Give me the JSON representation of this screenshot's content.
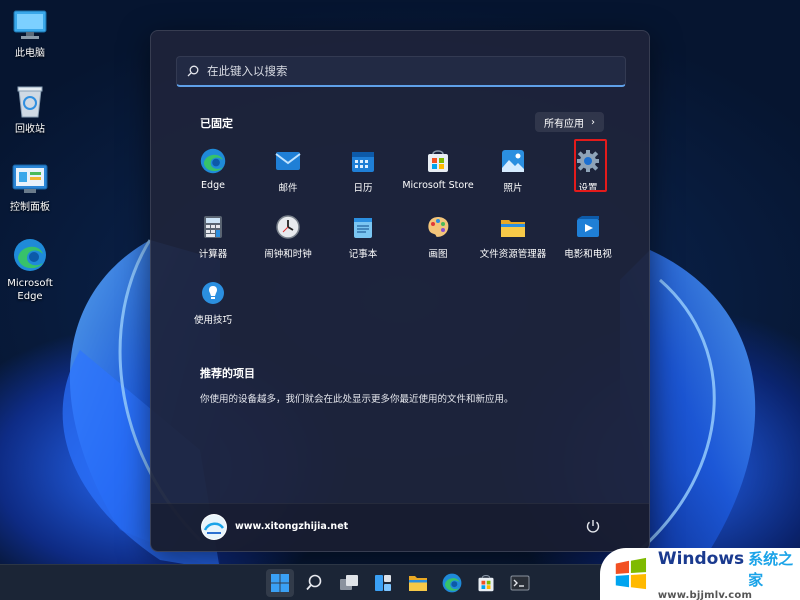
{
  "desktop": {
    "icons": [
      {
        "label": "此电脑",
        "icon": "computer-icon"
      },
      {
        "label": "回收站",
        "icon": "recycle-bin-icon"
      },
      {
        "label": "控制面板",
        "icon": "control-panel-icon"
      },
      {
        "label": "Microsoft\nEdge",
        "icon": "edge-icon"
      }
    ]
  },
  "start_menu": {
    "search_placeholder": "在此键入以搜索",
    "pinned_title": "已固定",
    "all_apps_label": "所有应用",
    "pinned_apps": [
      {
        "name": "Edge",
        "icon": "edge-icon"
      },
      {
        "name": "邮件",
        "icon": "mail-icon"
      },
      {
        "name": "日历",
        "icon": "calendar-icon"
      },
      {
        "name": "Microsoft Store",
        "icon": "store-icon"
      },
      {
        "name": "照片",
        "icon": "photos-icon"
      },
      {
        "name": "设置",
        "icon": "settings-icon"
      },
      {
        "name": "计算器",
        "icon": "calculator-icon"
      },
      {
        "name": "闹钟和时钟",
        "icon": "clock-icon"
      },
      {
        "name": "记事本",
        "icon": "notepad-icon"
      },
      {
        "name": "画图",
        "icon": "paint-icon"
      },
      {
        "name": "文件资源管理器",
        "icon": "folder-icon"
      },
      {
        "name": "电影和电视",
        "icon": "movies-icon"
      },
      {
        "name": "使用技巧",
        "icon": "tips-icon"
      }
    ],
    "recommended_title": "推荐的项目",
    "recommended_text": "你使用的设备越多，我们就会在此处显示更多你最近使用的文件和新应用。",
    "user_name": "www.xitongzhijia.net"
  },
  "taskbar": {
    "items": [
      "start-icon",
      "search-icon",
      "task-view-icon",
      "widgets-icon",
      "file-explorer-icon",
      "edge-icon",
      "store-icon",
      "terminal-icon"
    ]
  },
  "watermark": {
    "brand": "Windows",
    "brand_cn": "系统之家",
    "url": "www.bjjmlv.com"
  },
  "colors": {
    "accent": "#5fa0e8",
    "highlight_box": "#e31b1b",
    "menu_bg": "#1e243a"
  }
}
